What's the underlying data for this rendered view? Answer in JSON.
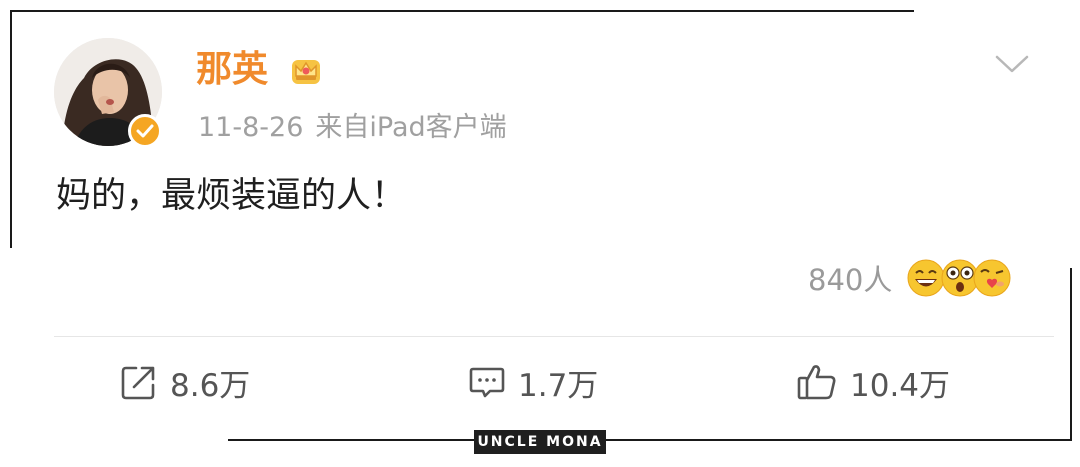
{
  "post": {
    "username": "那英",
    "date": "11-8-26",
    "source": "来自iPad客户端",
    "text": "妈的，最烦装逼的人！",
    "reaction_count": "840人"
  },
  "actions": {
    "repost": "8.6万",
    "comment": "1.7万",
    "like": "10.4万"
  },
  "watermark": "UNCLE MONA",
  "icons": {
    "crown": "crown-icon",
    "verified": "verified-badge-icon",
    "chevron": "chevron-down-icon",
    "repost": "repost-icon",
    "comment": "comment-icon",
    "like": "thumbs-up-icon"
  },
  "colors": {
    "username": "#f08a2c",
    "verified": "#f5a623",
    "meta_text": "#a0a0a0",
    "action_text": "#555555"
  }
}
